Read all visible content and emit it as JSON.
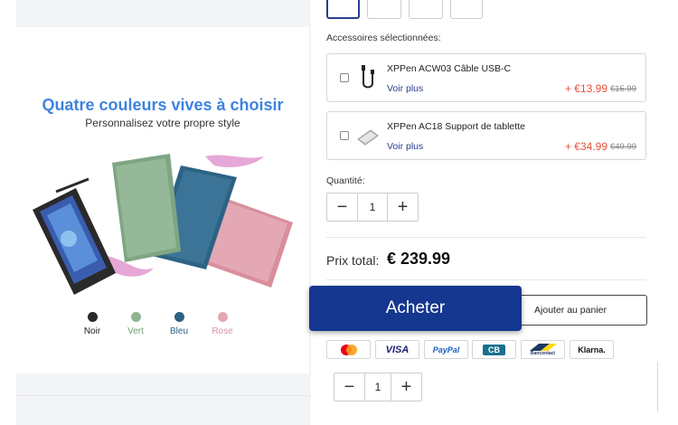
{
  "promo": {
    "title": "Quatre couleurs vives à choisir",
    "subtitle": "Personnalisez votre propre style",
    "colors": [
      {
        "label": "Noir",
        "hex": "#2a2a2a",
        "text_color": "#222222"
      },
      {
        "label": "Vert",
        "hex": "#8fb590",
        "text_color": "#6f9b72"
      },
      {
        "label": "Bleu",
        "hex": "#2c6385",
        "text_color": "#2c6385"
      },
      {
        "label": "Rose",
        "hex": "#e3a8b4",
        "text_color": "#d9909f"
      }
    ]
  },
  "accessories": {
    "label": "Accessoires sélectionnées:",
    "items": [
      {
        "name": "XPPen ACW03 Câble USB-C",
        "more": "Voir plus",
        "price": "+ €13.99",
        "old_price": "€15.99",
        "icon": "usb-cable-icon"
      },
      {
        "name": "XPPen AC18 Support de tablette",
        "more": "Voir plus",
        "price": "+ €34.99",
        "old_price": "€49.99",
        "icon": "tablet-stand-icon"
      }
    ]
  },
  "quantity": {
    "label": "Quantité:",
    "value": "1",
    "minus": "−",
    "plus": "+"
  },
  "total": {
    "label": "Prix total:",
    "value": "€ 239.99"
  },
  "actions": {
    "buy": "Acheter",
    "cart": "Ajouter au panier"
  },
  "payments": [
    "Mastercard",
    "VISA",
    "PayPal",
    "CB",
    "Bancontact",
    "Klarna."
  ],
  "sticky_quantity": {
    "value": "1",
    "minus": "−",
    "plus": "+"
  },
  "colors_ui": {
    "accent": "#15378f",
    "price": "#e8513c",
    "title_blue": "#3f83e0"
  }
}
